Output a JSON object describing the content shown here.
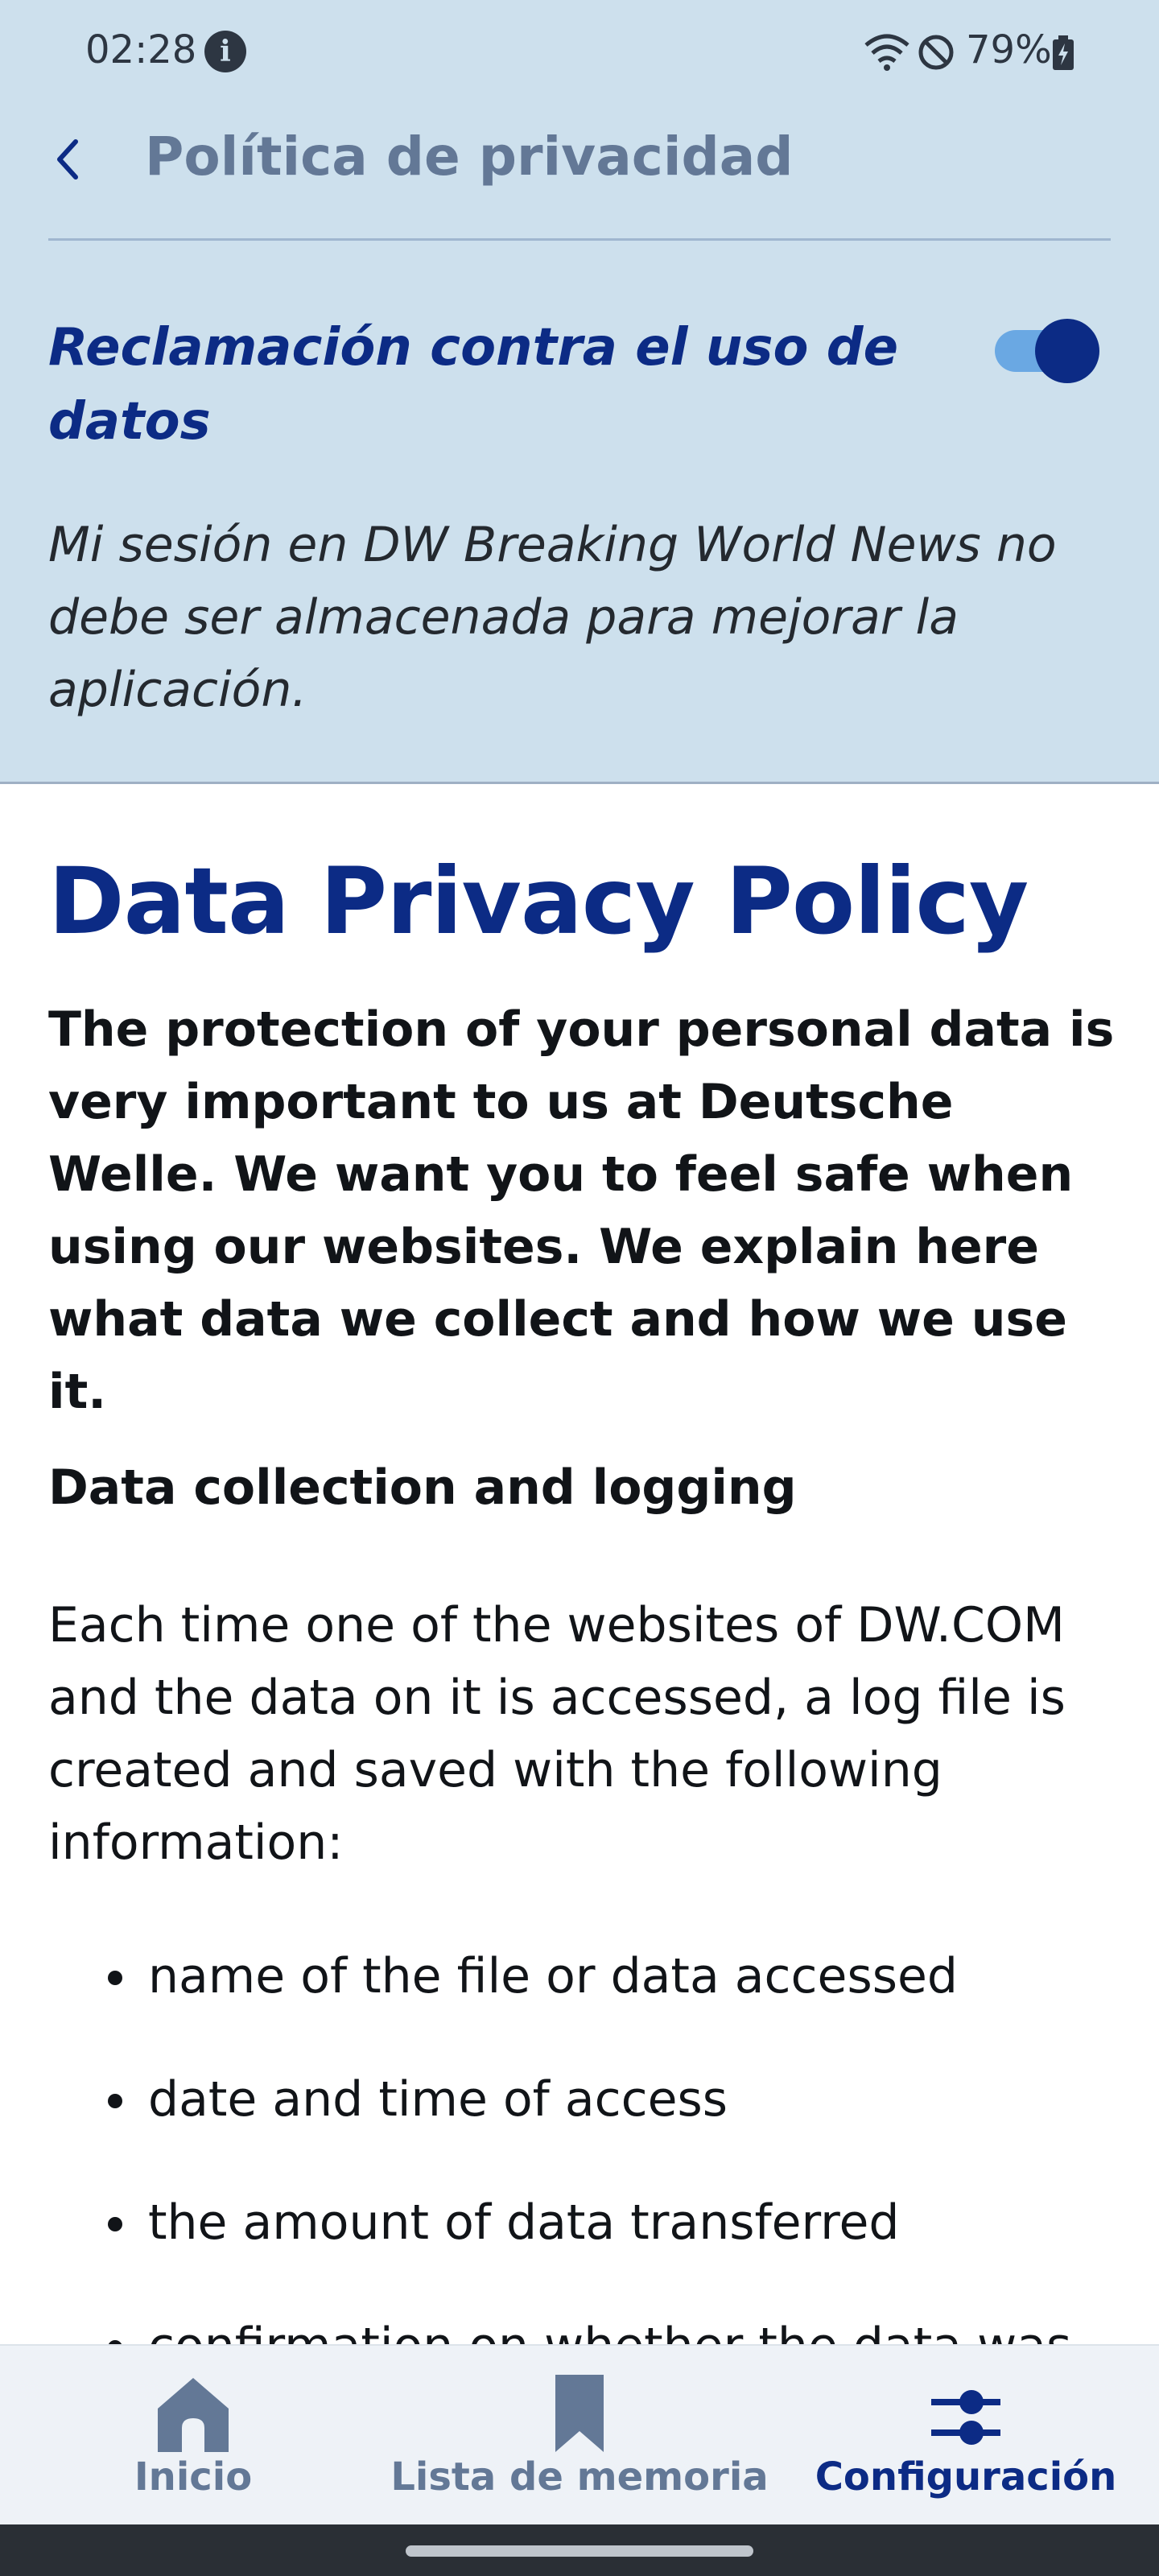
{
  "status_bar": {
    "time": "02:28",
    "battery": "79%"
  },
  "app_bar": {
    "title": "Política de privacidad"
  },
  "claim": {
    "title": "Reclamación contra el uso de datos",
    "description": "Mi sesión en DW Breaking World News no debe ser almacenada para mejorar la aplicación.",
    "toggle_on": true
  },
  "policy": {
    "title": "Data Privacy Policy",
    "intro": "The protection of your personal data is very important to us at Deutsche Welle. We want you to feel safe when using our websites. We explain here what data we collect and how we use it.",
    "section_heading": "Data collection and logging",
    "body": "Each time one of the websites of DW.COM and the data on it is accessed, a log file is created and saved with the following information:",
    "bullets": [
      "name of the file or data accessed",
      "date and time of access",
      "the amount of data transferred",
      "confirmation on whether the data was accessed successfully"
    ]
  },
  "bottom_nav": {
    "items": [
      {
        "label": "Inicio",
        "icon": "home-icon",
        "active": false
      },
      {
        "label": "Lista de memoria",
        "icon": "bookmark-icon",
        "active": false
      },
      {
        "label": "Configuración",
        "icon": "sliders-icon",
        "active": true
      }
    ]
  },
  "colors": {
    "header_bg": "#cde0ed",
    "accent": "#0c2b85",
    "muted": "#637896",
    "toggle_track": "#6aa8e3"
  }
}
